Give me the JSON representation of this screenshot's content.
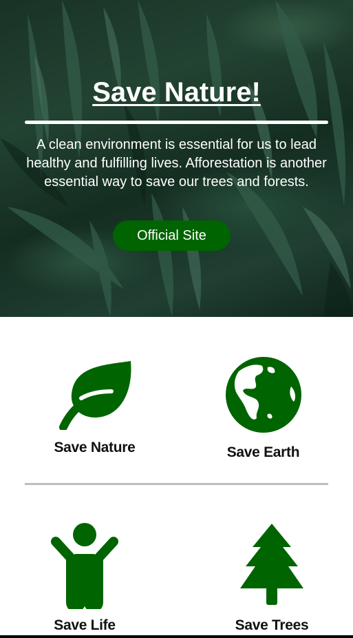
{
  "hero": {
    "title": "Save Nature!",
    "text_lines": [
      "A clean environment is essential for us to lead",
      "healthy and fulfilling lives. Afforestation is another",
      "essential way to save our trees and forests."
    ],
    "button_label": "Official Site"
  },
  "features": [
    {
      "label": "Save Nature",
      "icon": "leaf-icon"
    },
    {
      "label": "Save Earth",
      "icon": "globe-icon"
    },
    {
      "label": "Save Life",
      "icon": "person-icon"
    },
    {
      "label": "Save Trees",
      "icon": "tree-icon"
    }
  ],
  "colors": {
    "accent_green": "#006400",
    "divider": "#bdbdbd",
    "text_dark": "#111111"
  }
}
